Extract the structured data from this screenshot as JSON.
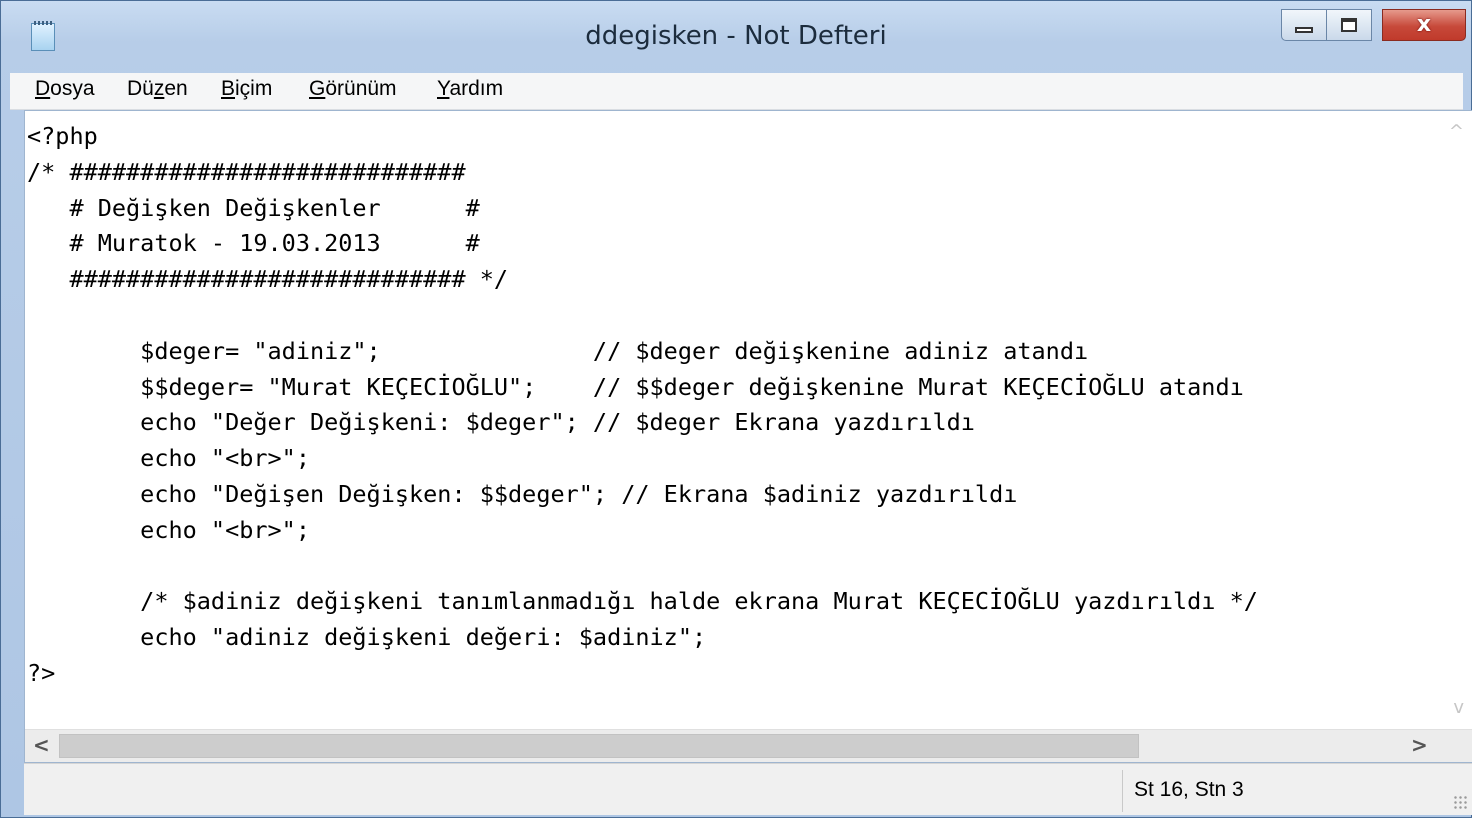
{
  "window": {
    "title": "ddegisken - Not Defteri",
    "close_glyph": "x"
  },
  "menu": {
    "items": [
      {
        "underline": "D",
        "rest": "osya"
      },
      {
        "prefix": "Dü",
        "underline": "z",
        "rest": "en"
      },
      {
        "underline": "B",
        "rest": "içim"
      },
      {
        "underline": "G",
        "rest": "örünüm"
      },
      {
        "underline": "Y",
        "rest": "ardım"
      }
    ]
  },
  "editor": {
    "content": "<?php\n/* ############################\n   # Değişken Değişkenler      #\n   # Muratok - 19.03.2013      #\n   ############################ */\n\n        $deger= \"adiniz\";               // $deger değişkenine adiniz atandı\n        $$deger= \"Murat KEÇECİOĞLU\";    // $$deger değişkenine Murat KEÇECİOĞLU atandı\n        echo \"Değer Değişkeni: $deger\"; // $deger Ekrana yazdırıldı\n        echo \"<br>\";\n        echo \"Değişen Değişken: $$deger\"; // Ekrana $adiniz yazdırıldı\n        echo \"<br>\";\n\n        /* $adiniz değişkeni tanımlanmadığı halde ekrana Murat KEÇECİOĞLU yazdırıldı */\n        echo \"adiniz değişkeni değeri: $adiniz\";\n?>"
  },
  "scrollbar": {
    "up": "^",
    "down": "v",
    "left": "<",
    "right": ">"
  },
  "status": {
    "position": "St 16, Stn 3"
  },
  "icons": [
    "notepad-icon",
    "minimize-icon",
    "maximize-icon",
    "close-icon",
    "resize-grip-icon"
  ]
}
